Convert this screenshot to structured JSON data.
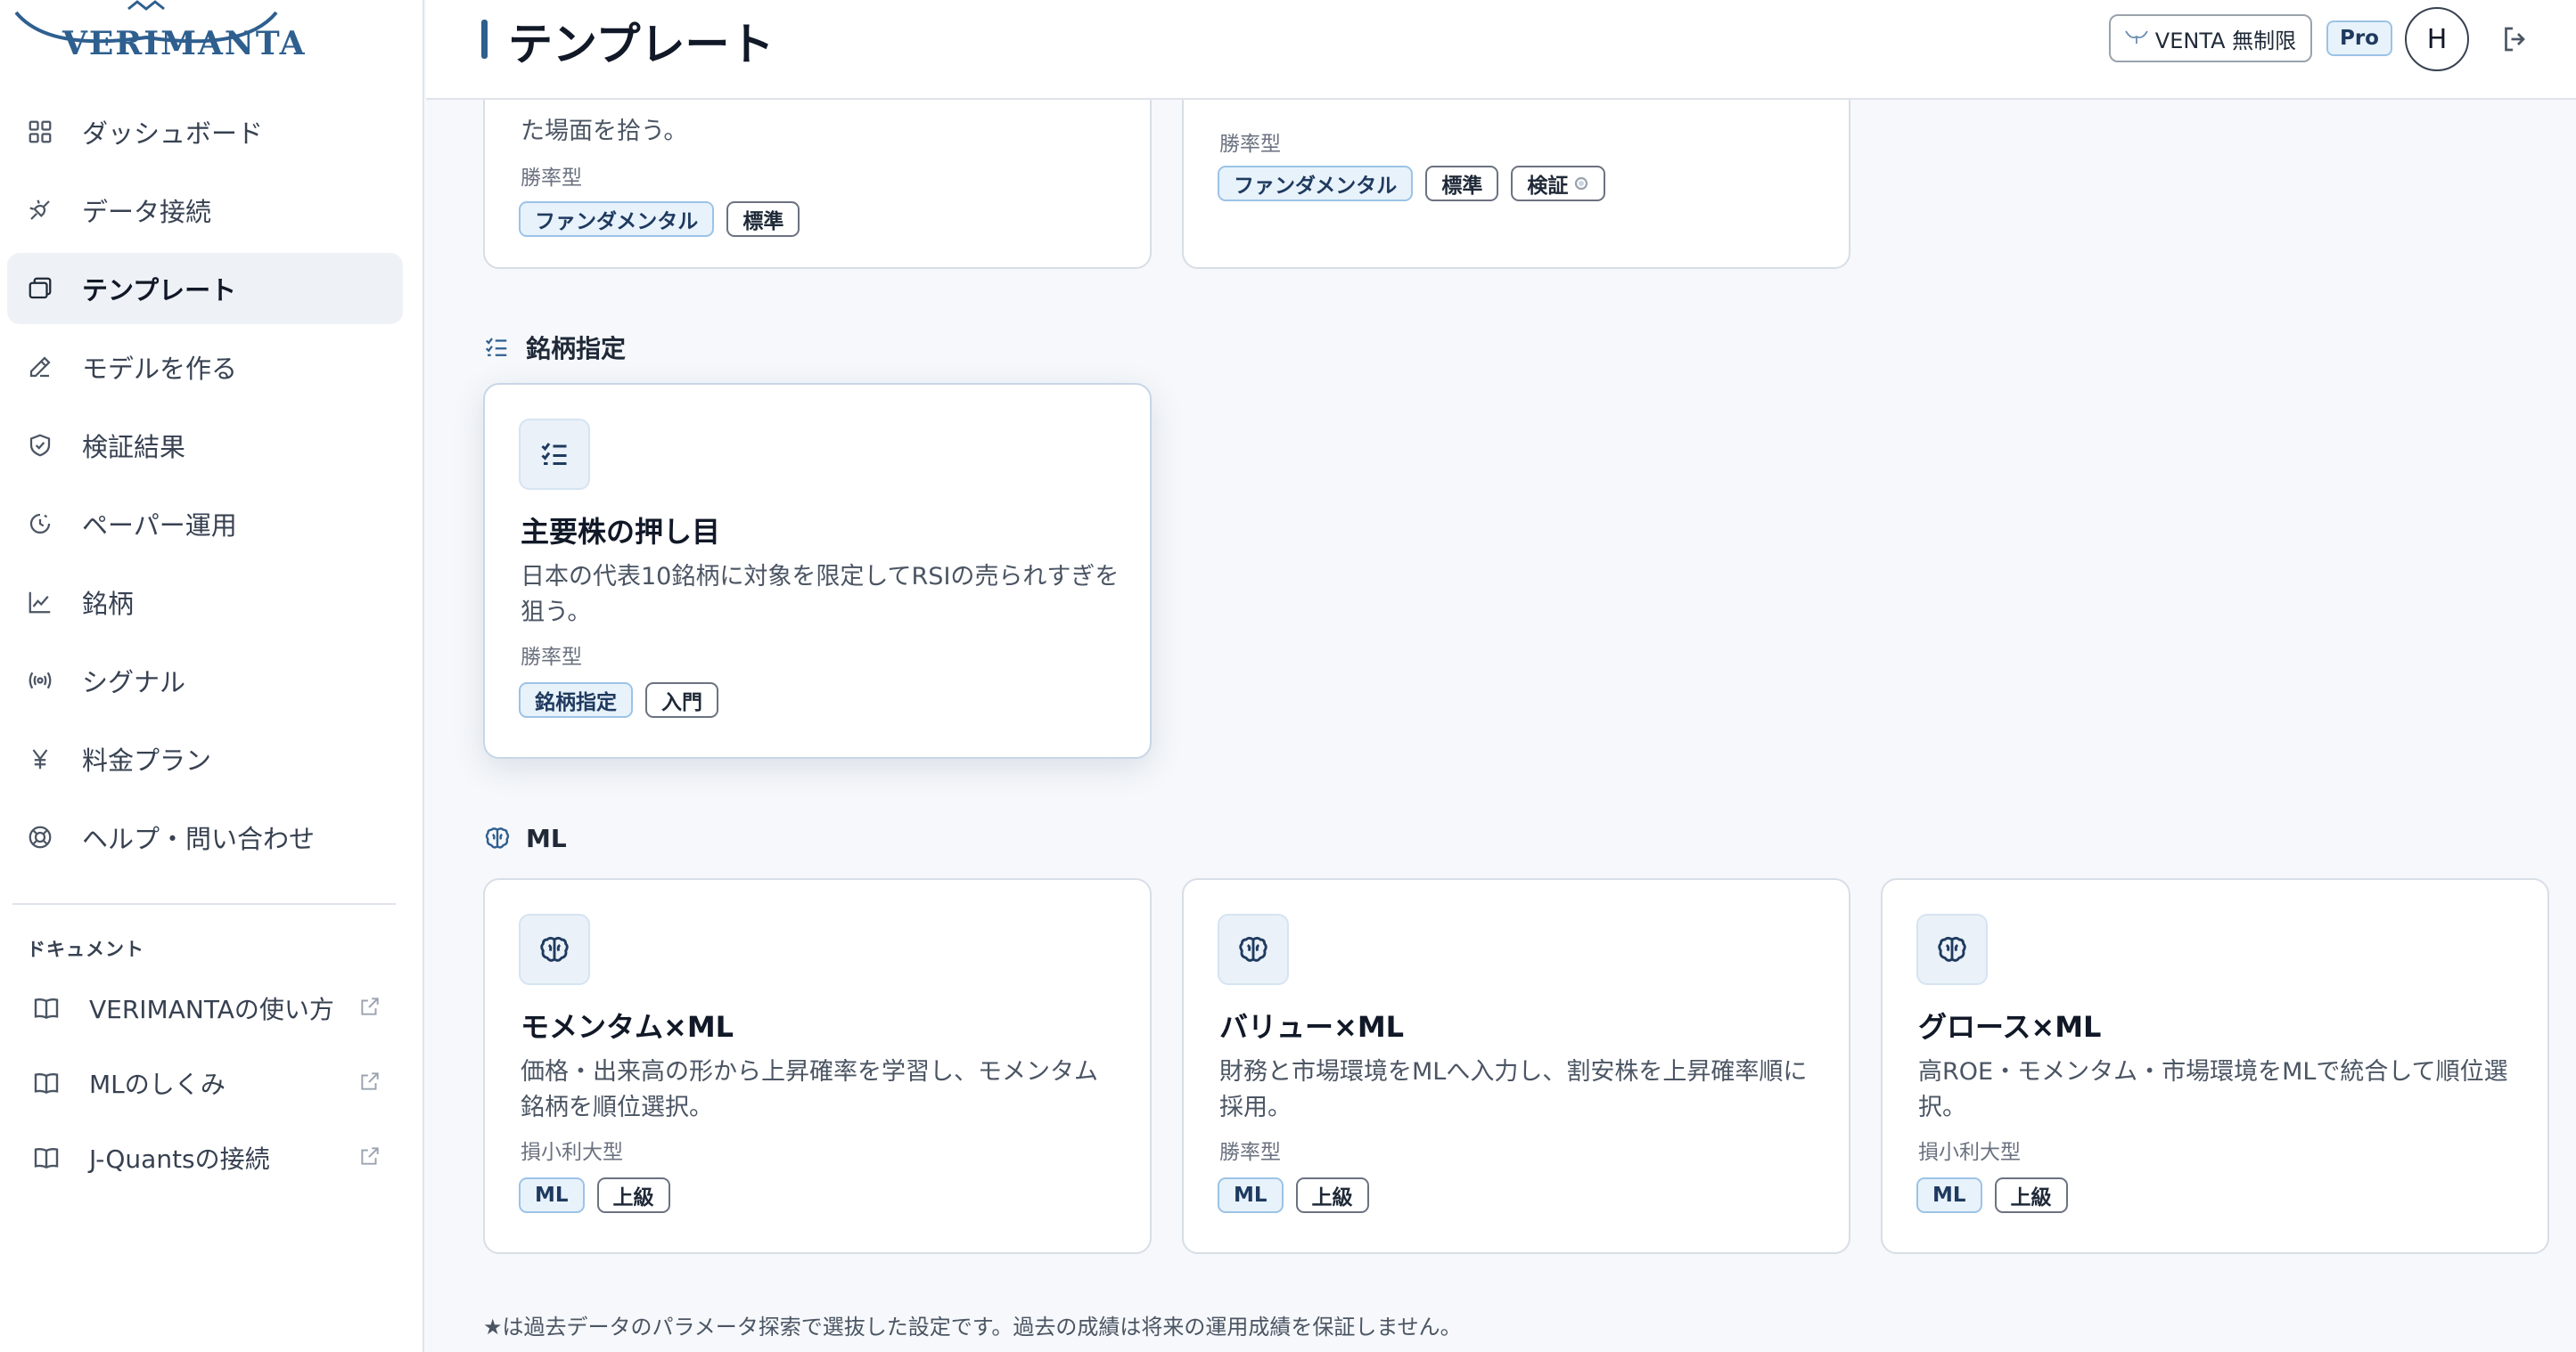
{
  "brand": {
    "name": "VERIMANTA"
  },
  "sidebar": {
    "items": [
      {
        "label": "ダッシュボード",
        "icon": "grid-icon"
      },
      {
        "label": "データ接続",
        "icon": "plug-icon"
      },
      {
        "label": "テンプレート",
        "icon": "copy-icon",
        "active": true
      },
      {
        "label": "モデルを作る",
        "icon": "pencil-icon"
      },
      {
        "label": "検証結果",
        "icon": "shield-check-icon"
      },
      {
        "label": "ペーパー運用",
        "icon": "clock-icon"
      },
      {
        "label": "銘柄",
        "icon": "line-chart-icon"
      },
      {
        "label": "シグナル",
        "icon": "radio-signal-icon"
      },
      {
        "label": "料金プラン",
        "icon": "yen-icon"
      },
      {
        "label": "ヘルプ・問い合わせ",
        "icon": "lifebuoy-icon"
      }
    ],
    "docs_title": "ドキュメント",
    "docs": [
      {
        "label": "VERIMANTAの使い方",
        "icon": "book-icon"
      },
      {
        "label": "MLのしくみ",
        "icon": "book-icon"
      },
      {
        "label": "J-Quantsの接続",
        "icon": "book-icon"
      }
    ]
  },
  "header": {
    "title": "テンプレート",
    "venta_label": "VENTA 無制限",
    "plan_badge": "Pro",
    "avatar_initial": "H"
  },
  "partial_cards": [
    {
      "desc_tail": "た場面を拾う。",
      "type": "勝率型",
      "tags": [
        "ファンダメンタル",
        "標準"
      ]
    },
    {
      "type": "勝率型",
      "tags": [
        "ファンダメンタル",
        "標準",
        "検証"
      ]
    }
  ],
  "sections": {
    "stock": {
      "label": "銘柄指定",
      "cards": [
        {
          "title": "主要株の押し目",
          "desc": "日本の代表10銘柄に対象を限定してRSIの売られすぎを狙う。",
          "type": "勝率型",
          "tags": [
            "銘柄指定",
            "入門"
          ]
        }
      ]
    },
    "ml": {
      "label": "ML",
      "cards": [
        {
          "title": "モメンタム×ML",
          "desc": "価格・出来高の形から上昇確率を学習し、モメンタム銘柄を順位選択。",
          "type": "損小利大型",
          "tags": [
            "ML",
            "上級"
          ]
        },
        {
          "title": "バリュー×ML",
          "desc": "財務と市場環境をMLへ入力し、割安株を上昇確率順に採用。",
          "type": "勝率型",
          "tags": [
            "ML",
            "上級"
          ]
        },
        {
          "title": "グロース×ML",
          "desc": "高ROE・モメンタム・市場環境をMLで統合して順位選択。",
          "type": "損小利大型",
          "tags": [
            "ML",
            "上級"
          ]
        }
      ]
    }
  },
  "footnote": "★は過去データのパラメータ探索で選抜した設定です。過去の成績は将来の運用成績を保証しません。",
  "colors": {
    "accent": "#2e5f8f",
    "tag_primary_bg": "#e8f2fb",
    "active_nav_bg": "#eef1f6"
  }
}
